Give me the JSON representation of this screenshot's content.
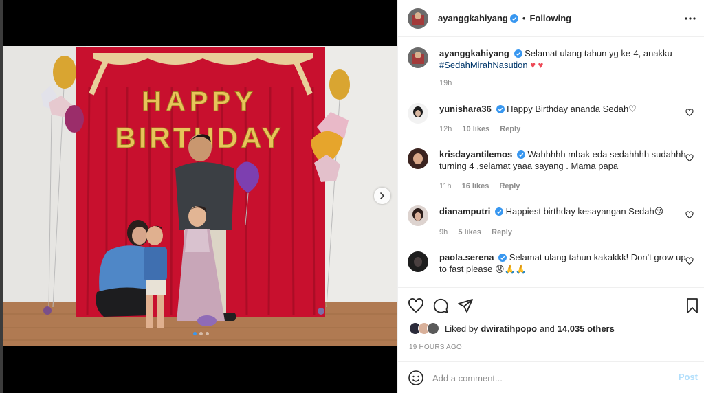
{
  "post": {
    "username": "ayanggkahiyang",
    "separator": "•",
    "following_label": "Following",
    "caption_text": "Selamat ulang tahun yg ke-4, anakku",
    "caption_hashtag": "#SedahMirahNasution",
    "caption_hearts": "♥ ♥",
    "caption_time": "19h",
    "photo_banner": "HAPPY BIRTHDAY",
    "image_count": 3,
    "active_image": 1
  },
  "comments": [
    {
      "username": "yunishara36",
      "text": "Happy Birthday ananda Sedah♡",
      "time": "12h",
      "likes": "10 likes",
      "reply": "Reply"
    },
    {
      "username": "krisdayantilemos",
      "text": "Wahhhhh mbak eda sedahhhh sudahhh turning 4 ,selamat yaaa sayang . Mama papa",
      "time": "11h",
      "likes": "16 likes",
      "reply": "Reply"
    },
    {
      "username": "dianamputri",
      "text": "Happiest birthday kesayangan Sedah😘",
      "time": "9h",
      "likes": "5 likes",
      "reply": "Reply"
    },
    {
      "username": "paola.serena",
      "text": "Selamat ulang tahun kakakkk! Don't grow up to fast please 😟🙏🙏",
      "time": "",
      "likes": "",
      "reply": ""
    }
  ],
  "likes": {
    "prefix": "Liked by",
    "user": "dwiratihpopo",
    "and": "and",
    "others": "14,035 others"
  },
  "timestamp": "19 HOURS AGO",
  "add_comment": {
    "placeholder": "Add a comment...",
    "post_label": "Post"
  },
  "colors": {
    "accent": "#0095f6",
    "verified": "#3897f0",
    "heart": "#ed4956",
    "post_disabled": "#b2dffc",
    "curtain": "#c8102e",
    "balloon_gold": "#d9a531"
  }
}
